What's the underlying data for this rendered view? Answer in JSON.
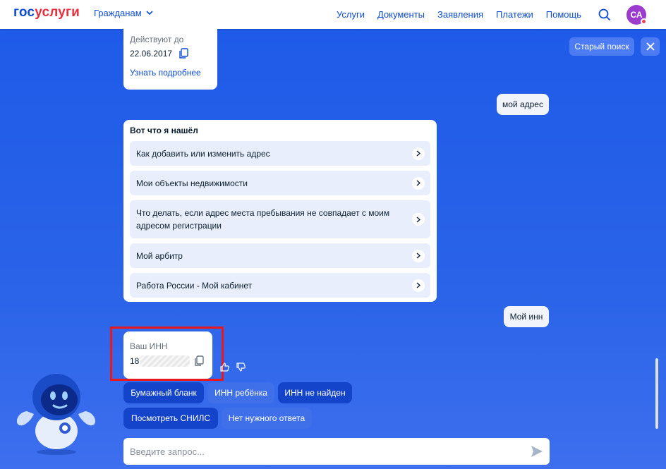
{
  "header": {
    "logo_part1": "гос",
    "logo_part2": "услуги",
    "audience_selector": "Гражданам",
    "nav": [
      "Услуги",
      "Документы",
      "Заявления",
      "Платежи",
      "Помощь"
    ],
    "avatar_initials": "СА",
    "brand_color": "#0d4cd3",
    "accent_red": "#e62e3d"
  },
  "controls": {
    "old_search_label": "Старый поиск"
  },
  "chat": {
    "doc_card": {
      "valid_until_label": "Действуют до",
      "valid_until_value": "22.06.2017",
      "more_link": "Узнать подробнее"
    },
    "user_msg_1": "мой адрес",
    "results_card": {
      "title": "Вот что я нашёл",
      "items": [
        "Как добавить или изменить адрес",
        "Мои объекты недвижимости",
        "Что делать, если адрес места пребывания не совпадает с моим адресом регистрации",
        "Мой арбитр",
        "Работа России - Мой кабинет"
      ]
    },
    "user_msg_2": "Мой инн",
    "inn_card": {
      "label": "Ваш ИНН",
      "value_visible": "18"
    },
    "chips": {
      "row1": [
        "Бумажный бланк",
        "ИНН ребёнка",
        "ИНН не найден"
      ],
      "row2": [
        "Посмотреть СНИЛС",
        "Нет нужного ответа"
      ]
    }
  },
  "input": {
    "placeholder": "Введите запрос..."
  }
}
